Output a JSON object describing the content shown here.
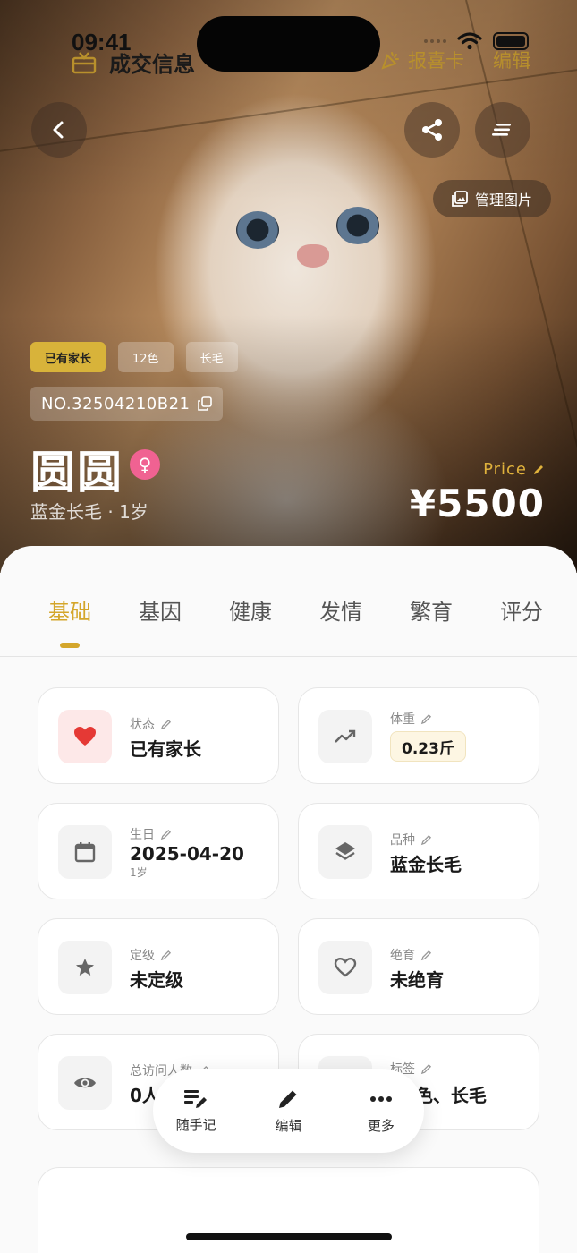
{
  "status_bar": {
    "time": "09:41"
  },
  "hero": {
    "manage_images_label": "管理图片",
    "chips": [
      "已有家长",
      "12色",
      "长毛"
    ],
    "code": "NO.32504210B21",
    "name": "圆圆",
    "gender_symbol": "♀",
    "breed_age": "蓝金长毛 · 1岁",
    "price_label": "Price",
    "price_value": "¥5500"
  },
  "tabs": [
    "基础",
    "基因",
    "健康",
    "发情",
    "繁育",
    "评分"
  ],
  "active_tab": "基础",
  "cards": {
    "status": {
      "label": "状态",
      "value": "已有家长"
    },
    "weight": {
      "label": "体重",
      "value": "0.23斤"
    },
    "birthday": {
      "label": "生日",
      "value": "2025-04-20",
      "sub": "1岁"
    },
    "breed": {
      "label": "品种",
      "value": "蓝金长毛"
    },
    "grade": {
      "label": "定级",
      "value": "未定级"
    },
    "neuter": {
      "label": "绝育",
      "value": "未绝育"
    },
    "visits": {
      "label": "总访问人数",
      "value": "0人"
    },
    "tags": {
      "label": "标签",
      "value": "12色、长毛"
    }
  },
  "toolbar": {
    "note": "随手记",
    "edit": "编辑",
    "more": "更多"
  },
  "deal": {
    "title": "成交信息",
    "report_card": "报喜卡",
    "edit": "编辑"
  },
  "colors": {
    "accent": "#d4a62b",
    "status_gold": "#d8b33a",
    "female_pink": "#f06292",
    "heart_red": "#e53935"
  }
}
